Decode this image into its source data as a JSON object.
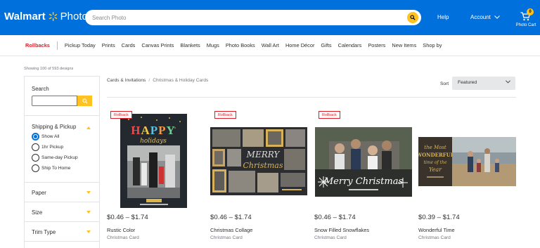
{
  "header": {
    "brand": "Walmart",
    "app": "Photo",
    "search_placeholder": "Search Photo",
    "help": "Help",
    "account": "Account",
    "cart_label": "Photo Cart",
    "cart_count": "0"
  },
  "nav": {
    "rollbacks": "Rollbacks",
    "items": [
      "Pickup Today",
      "Prints",
      "Cards",
      "Canvas Prints",
      "Blankets",
      "Mugs",
      "Photo Books",
      "Wall Art",
      "Home Décor",
      "Gifts",
      "Calendars",
      "Posters",
      "New Items",
      "Shop by"
    ]
  },
  "results_count": "Showing 100 of 593 designs",
  "sidebar": {
    "search_title": "Search",
    "shipping_title": "Shipping & Pickup",
    "options": [
      "Show All",
      "1hr Pickup",
      "Same-day Pickup",
      "Ship To Home"
    ],
    "selected_option": "Show All",
    "filters": [
      "Paper",
      "Size",
      "Trim Type"
    ]
  },
  "breadcrumb": {
    "parent": "Cards & Invitations",
    "separator": "/",
    "current": "Christmas & Holiday Cards"
  },
  "sort": {
    "label": "Sort",
    "value": "Featured"
  },
  "products": [
    {
      "tag": "Rollback",
      "price": "$0.46 – $1.74",
      "name": "Rustic Color",
      "type": "Christmas Card",
      "art_text": "HAPPY holidays"
    },
    {
      "tag": "Rollback",
      "price": "$0.46 – $1.74",
      "name": "Christmas Collage",
      "type": "Christmas Card",
      "art_text": "MERRY Christmas"
    },
    {
      "tag": "Rollback",
      "price": "$0.46 – $1.74",
      "name": "Snow Filled Snowflakes",
      "type": "Christmas Card",
      "art_text": "Merry Christmas"
    },
    {
      "tag": "",
      "price": "$0.39 – $1.74",
      "name": "Wonderful Time",
      "type": "Christmas Card",
      "art_text": "the Most WONDERFUL time of the Year"
    }
  ],
  "colors": {
    "header_blue": "#0071dc",
    "spark_yellow": "#ffc220",
    "rollback_red": "#de1c24"
  }
}
